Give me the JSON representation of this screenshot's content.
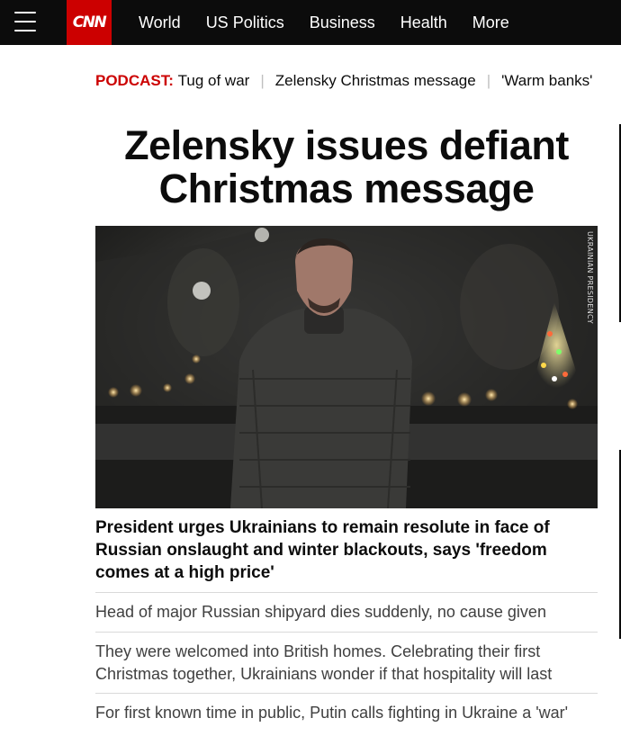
{
  "nav": {
    "logo": "CNN",
    "links": [
      "World",
      "US Politics",
      "Business",
      "Health",
      "More"
    ]
  },
  "ticker": {
    "label": "PODCAST:",
    "items": [
      "Tug of war",
      "Zelensky Christmas message",
      "'Warm banks'"
    ]
  },
  "article": {
    "headline": "Zelensky issues defiant Christmas message",
    "image_credit": "UKRAINIAN PRESIDENCY",
    "caption": "President urges Ukrainians to remain resolute in face of Russian onslaught and winter blackouts, says 'freedom comes at a high price'"
  },
  "related": [
    "Head of major Russian shipyard dies suddenly, no cause given",
    "They were welcomed into British homes. Celebrating their first Christmas together, Ukrainians wonder if that hospitality will last",
    "For first known time in public, Putin calls fighting in Ukraine a 'war'"
  ],
  "colors": {
    "brand_red": "#cc0000",
    "nav_bg": "#0c0c0c",
    "text": "#0c0c0c",
    "secondary_text": "#404040",
    "divider": "#d9d9d9"
  }
}
